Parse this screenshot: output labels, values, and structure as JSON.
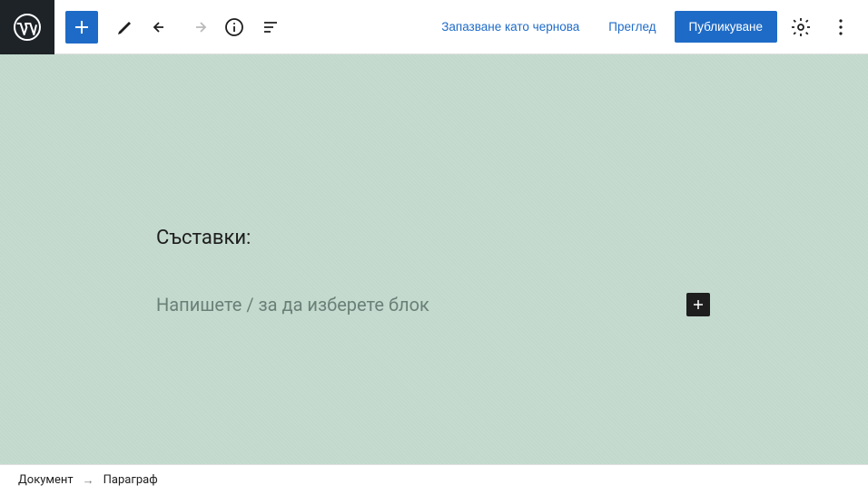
{
  "header": {
    "save_draft": "Запазване като чернова",
    "preview": "Преглед",
    "publish": "Публикуване"
  },
  "content": {
    "heading": "Съставки:",
    "paragraph_placeholder": "Напишете / за да изберете блок"
  },
  "breadcrumb": {
    "root": "Документ",
    "current": "Параграф"
  }
}
